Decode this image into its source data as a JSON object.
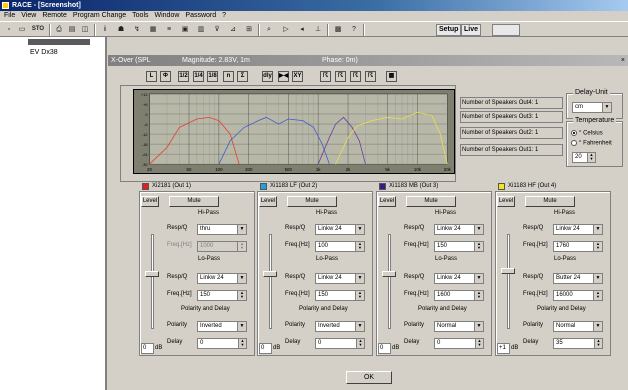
{
  "window": {
    "title": "RACE - [Screenshot]"
  },
  "menu": [
    "File",
    "View",
    "Remote",
    "Program Change",
    "Tools",
    "Window",
    "Password",
    "?"
  ],
  "toolbar": {
    "icons": [
      "new-icon",
      "open-icon",
      "sto-icon",
      "print-icon",
      "copy-icon",
      "preview-icon",
      "info-icon",
      "remote-icon",
      "plug-icon",
      "speaker-icon",
      "eq-icon",
      "graph-icon",
      "filter-icon",
      "chart-icon",
      "mixer-icon",
      "search-icon",
      "play-icon",
      "level-icon",
      "gain-icon",
      "grid-icon",
      "help-icon"
    ],
    "sto_label": "STO",
    "setup_label": "Setup",
    "live_label": "Live"
  },
  "tree": {
    "device": "EV Dx38"
  },
  "xover": {
    "title": "X-Over (SPL",
    "magnitude": "Magnitude: 2.83V, 1m",
    "phase": "Phase: 0m)",
    "buttons": [
      "L",
      "Φ",
      "1/2",
      "1/4",
      "1/8",
      "n",
      "Σ",
      "dly",
      "▶◀",
      "XY",
      "☈",
      "☈",
      "☈",
      "☈",
      "▦"
    ]
  },
  "graph": {
    "y_ticks": [
      "+12",
      "+6",
      "0",
      "-6",
      "-12",
      "-18",
      "-24",
      "-30"
    ],
    "x_ticks": [
      "20",
      "50",
      "100",
      "200",
      "500",
      "1k",
      "2k",
      "5k",
      "10k",
      "20k"
    ]
  },
  "chart_data": {
    "type": "line",
    "title": "",
    "xlabel": "",
    "ylabel": "",
    "xscale": "log",
    "xlim": [
      20,
      20000
    ],
    "ylim": [
      -30,
      12
    ],
    "series": [
      {
        "name": "Out 1",
        "color": "#e43c2e",
        "x": [
          20,
          30,
          40,
          60,
          80,
          100,
          130,
          160
        ],
        "y": [
          -30,
          -20,
          -8,
          -3,
          -2,
          -4,
          -12,
          -30
        ]
      },
      {
        "name": "Out 2",
        "color": "#3b5bd0",
        "x": [
          100,
          130,
          180,
          250,
          300,
          400,
          500,
          700,
          900,
          1100,
          1300
        ],
        "y": [
          -30,
          -16,
          -8,
          -4,
          -2,
          -6,
          -3,
          -4,
          -8,
          -18,
          -30
        ]
      },
      {
        "name": "Out 3",
        "color": "#6a3aa0",
        "x": [
          1000,
          1300,
          1500,
          1800,
          2200,
          2600,
          3000
        ],
        "y": [
          -30,
          -14,
          -6,
          -2,
          -8,
          -16,
          -30
        ]
      },
      {
        "name": "Out 4",
        "color": "#e8e050",
        "x": [
          1500,
          2000,
          2500,
          3500,
          5000,
          7000,
          10000,
          14000,
          17000,
          20000
        ],
        "y": [
          -30,
          -14,
          -7,
          -4,
          -2,
          -3,
          1,
          -1,
          -12,
          -30
        ]
      }
    ]
  },
  "speakers": [
    {
      "label": "Number of Speakers Out4: 1"
    },
    {
      "label": "Number of Speakers Out3: 1"
    },
    {
      "label": "Number of Speakers Out2: 1"
    },
    {
      "label": "Number of Speakers Out1: 1"
    }
  ],
  "delay_unit": {
    "label": "Delay-Unit",
    "value": "cm"
  },
  "temperature": {
    "label": "Temperature",
    "celsius": "° Celsius",
    "fahrenheit": "° Fahrenheit",
    "value": "20",
    "selected": "celsius"
  },
  "channels": [
    {
      "name": "Xi2181 (Out 1)",
      "color": "#e41e1e",
      "level": "Level",
      "mute": "Mute",
      "hipass": "Hi-Pass",
      "lopass": "Lo-Pass",
      "pd": "Polarity and Delay",
      "hp_respq": "thru",
      "hp_freq": "1000",
      "hp_freq_disabled": true,
      "lp_respq": "Linkw 24",
      "lp_freq": "150",
      "polarity": "Inverted",
      "delay": "0",
      "gain": "0",
      "db": "dB",
      "thumb": 0.42,
      "resp_label": "Resp/Q",
      "freq_label": "Freq.[Hz]",
      "pol_label": "Polarity",
      "delay_label": "Delay"
    },
    {
      "name": "Xi1183 LF (Out 2)",
      "color": "#1ea0e4",
      "level": "Level",
      "mute": "Mute",
      "hipass": "Hi-Pass",
      "lopass": "Lo-Pass",
      "pd": "Polarity and Delay",
      "hp_respq": "Linkw 24",
      "hp_freq": "100",
      "hp_freq_disabled": false,
      "lp_respq": "Linkw 24",
      "lp_freq": "150",
      "polarity": "Inverted",
      "delay": "0",
      "gain": "0",
      "db": "dB",
      "thumb": 0.42,
      "resp_label": "Resp/Q",
      "freq_label": "Freq.[Hz]",
      "pol_label": "Polarity",
      "delay_label": "Delay"
    },
    {
      "name": "Xi1183 MB (Out 3)",
      "color": "#3a1a8a",
      "level": "Level",
      "mute": "Mute",
      "hipass": "Hi-Pass",
      "lopass": "Lo-Pass",
      "pd": "Polarity and Delay",
      "hp_respq": "Linkw 24",
      "hp_freq": "150",
      "hp_freq_disabled": false,
      "lp_respq": "Linkw 24",
      "lp_freq": "1600",
      "polarity": "Normal",
      "delay": "0",
      "gain": "0",
      "db": "dB",
      "thumb": 0.42,
      "resp_label": "Resp/Q",
      "freq_label": "Freq.[Hz]",
      "pol_label": "Polarity",
      "delay_label": "Delay"
    },
    {
      "name": "Xi1183 HF (Out 4)",
      "color": "#f0e81e",
      "level": "Level",
      "mute": "Mute",
      "hipass": "Hi-Pass",
      "lopass": "Lo-Pass",
      "pd": "Polarity and Delay",
      "hp_respq": "Linkw 24",
      "hp_freq": "1760",
      "hp_freq_disabled": false,
      "lp_respq": "Butter 24",
      "lp_freq": "16000",
      "polarity": "Normal",
      "delay": "35",
      "gain": "+1",
      "db": "dB",
      "thumb": 0.38,
      "resp_label": "Resp/Q",
      "freq_label": "Freq.[Hz]",
      "pol_label": "Polarity",
      "delay_label": "Delay"
    }
  ],
  "ok_label": "OK"
}
